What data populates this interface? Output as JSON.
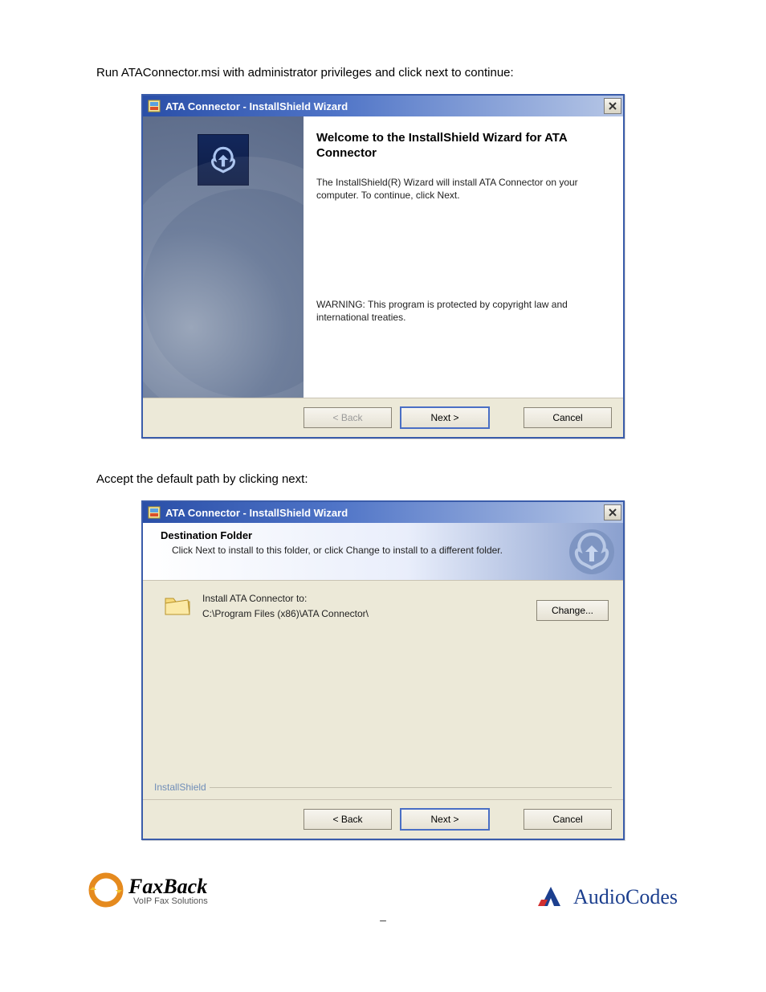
{
  "intro": {
    "line1": "Run ATAConnector.msi with administrator privileges and click next to continue:"
  },
  "dialog1": {
    "title": "ATA Connector - InstallShield Wizard",
    "heading": "Welcome to the InstallShield Wizard for ATA Connector",
    "para": "The InstallShield(R) Wizard will install ATA Connector on your computer. To continue, click Next.",
    "warning": "WARNING: This program is protected by copyright law and international treaties.",
    "buttons": {
      "back": "< Back",
      "next": "Next >",
      "cancel": "Cancel"
    }
  },
  "midtext": "Accept the default path by clicking next:",
  "dialog2": {
    "title": "ATA Connector - InstallShield Wizard",
    "header_title": "Destination Folder",
    "header_sub": "Click Next to install to this folder, or click Change to install to a different folder.",
    "install_label": "Install ATA Connector to:",
    "install_path": "C:\\Program Files (x86)\\ATA Connector\\",
    "change": "Change...",
    "brand": "InstallShield",
    "buttons": {
      "back": "< Back",
      "next": "Next >",
      "cancel": "Cancel"
    }
  },
  "footer": {
    "faxback_brand": "FaxBack",
    "faxback_tag": "VoIP Fax Solutions",
    "audiocodes_brand": "AudioCodes",
    "page_dash": "–"
  },
  "icons": {
    "close": "close-icon",
    "app": "installshield-app-icon",
    "folder": "folder-icon",
    "faxback_ring": "faxback-ring-icon",
    "audiocodes_mark": "audiocodes-mark-icon"
  }
}
